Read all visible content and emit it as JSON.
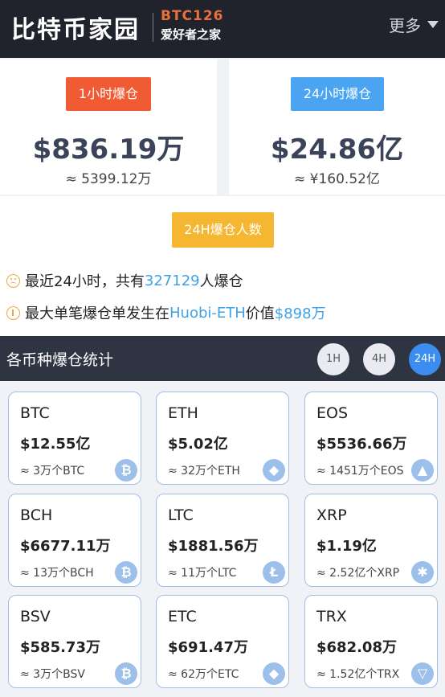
{
  "header": {
    "logo_main": "比特币家园",
    "logo_code": "BTC126",
    "logo_sub": "爱好者之家",
    "more_label": "更多"
  },
  "summary": {
    "left": {
      "tag": "1小时爆仓",
      "amount": "$836.19万",
      "approx": "≈ 5399.12万"
    },
    "right": {
      "tag": "24小时爆仓",
      "amount": "$24.86亿",
      "approx": "≈ ¥160.52亿"
    }
  },
  "mid": {
    "tag": "24H爆仓人数",
    "line1_prefix": "最近24小时，共有",
    "line1_count": "327129",
    "line1_suffix": "人爆仓",
    "line2_prefix": "最大单笔爆仓单发生在",
    "line2_exchange": "Huobi-ETH",
    "line2_mid": "价值",
    "line2_value": "$898万"
  },
  "stats": {
    "title": "各币种爆仓统计",
    "tabs": [
      "1H",
      "4H",
      "24H"
    ],
    "active_tab": "24H"
  },
  "coins": [
    {
      "name": "BTC",
      "value": "$12.55亿",
      "sub": "≈ 3万个BTC",
      "icon": "bitcoin-icon",
      "glyph": "₿"
    },
    {
      "name": "ETH",
      "value": "$5.02亿",
      "sub": "≈ 32万个ETH",
      "icon": "ethereum-icon",
      "glyph": "◆"
    },
    {
      "name": "EOS",
      "value": "$5536.66万",
      "sub": "≈ 1451万个EOS",
      "icon": "eos-icon",
      "glyph": "▲"
    },
    {
      "name": "BCH",
      "value": "$6677.11万",
      "sub": "≈ 13万个BCH",
      "icon": "bitcoin-cash-icon",
      "glyph": "₿"
    },
    {
      "name": "LTC",
      "value": "$1881.56万",
      "sub": "≈ 11万个LTC",
      "icon": "litecoin-icon",
      "glyph": "Ł"
    },
    {
      "name": "XRP",
      "value": "$1.19亿",
      "sub": "≈ 2.52亿个XRP",
      "icon": "ripple-icon",
      "glyph": "✱"
    },
    {
      "name": "BSV",
      "value": "$585.73万",
      "sub": "≈ 3万个BSV",
      "icon": "bitcoin-sv-icon",
      "glyph": "₿"
    },
    {
      "name": "ETC",
      "value": "$691.47万",
      "sub": "≈ 62万个ETC",
      "icon": "ethereum-classic-icon",
      "glyph": "◆"
    },
    {
      "name": "TRX",
      "value": "$682.08万",
      "sub": "≈ 1.52亿个TRX",
      "icon": "tron-icon",
      "glyph": "▽"
    }
  ],
  "colors": {
    "header_bg": "#20232c",
    "accent_red": "#f05b33",
    "accent_blue": "#4ba4f1",
    "accent_yellow": "#f5b731",
    "link_blue": "#3ea1e8",
    "stats_bar_bg": "#2f3442",
    "active_tab": "#3b8ef0"
  }
}
